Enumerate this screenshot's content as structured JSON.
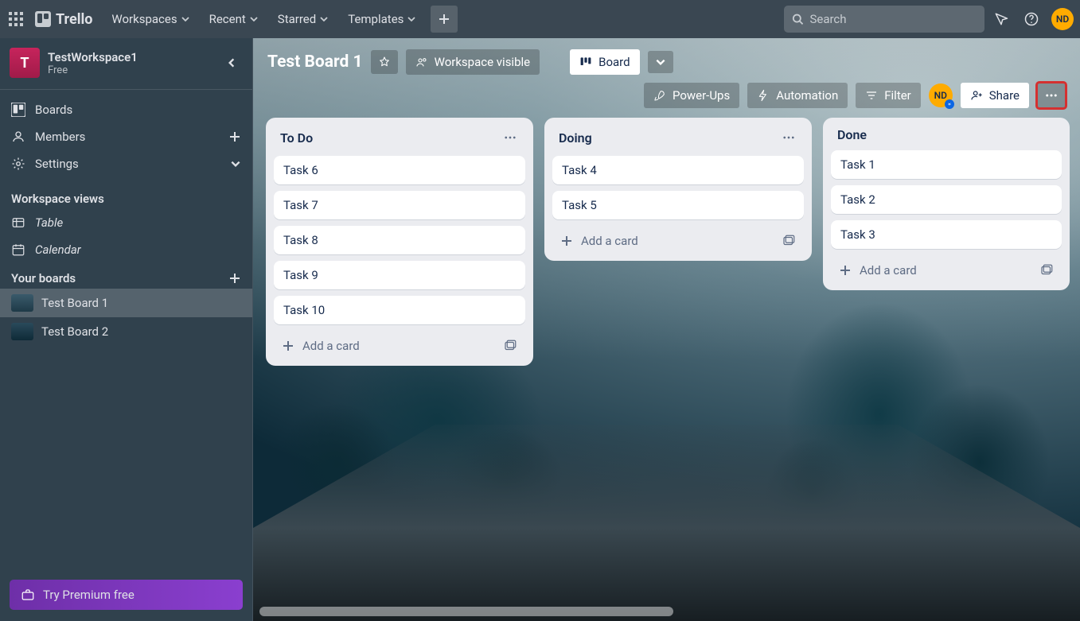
{
  "topnav": {
    "logo_text": "Trello",
    "items": [
      "Workspaces",
      "Recent",
      "Starred",
      "Templates"
    ],
    "search_placeholder": "Search",
    "avatar_initials": "ND"
  },
  "sidebar": {
    "workspace": {
      "initial": "T",
      "name": "TestWorkspace1",
      "plan": "Free"
    },
    "nav": {
      "boards": "Boards",
      "members": "Members",
      "settings": "Settings"
    },
    "views_heading": "Workspace views",
    "views": {
      "table": "Table",
      "calendar": "Calendar"
    },
    "yourboards_heading": "Your boards",
    "boards": [
      {
        "name": "Test Board 1",
        "active": true
      },
      {
        "name": "Test Board 2",
        "active": false
      }
    ],
    "premium_cta": "Try Premium free"
  },
  "board": {
    "title": "Test Board 1",
    "visibility_label": "Workspace visible",
    "view_button_label": "Board",
    "actions": {
      "powerups": "Power-Ups",
      "automation": "Automation",
      "filter": "Filter",
      "share": "Share"
    },
    "member_initials": "ND",
    "lists": [
      {
        "title": "To Do",
        "cards": [
          "Task 6",
          "Task 7",
          "Task 8",
          "Task 9",
          "Task 10"
        ]
      },
      {
        "title": "Doing",
        "cards": [
          "Task 4",
          "Task 5"
        ]
      },
      {
        "title": "Done",
        "cards": [
          "Task 1",
          "Task 2",
          "Task 3"
        ]
      }
    ],
    "add_card_label": "Add a card"
  }
}
